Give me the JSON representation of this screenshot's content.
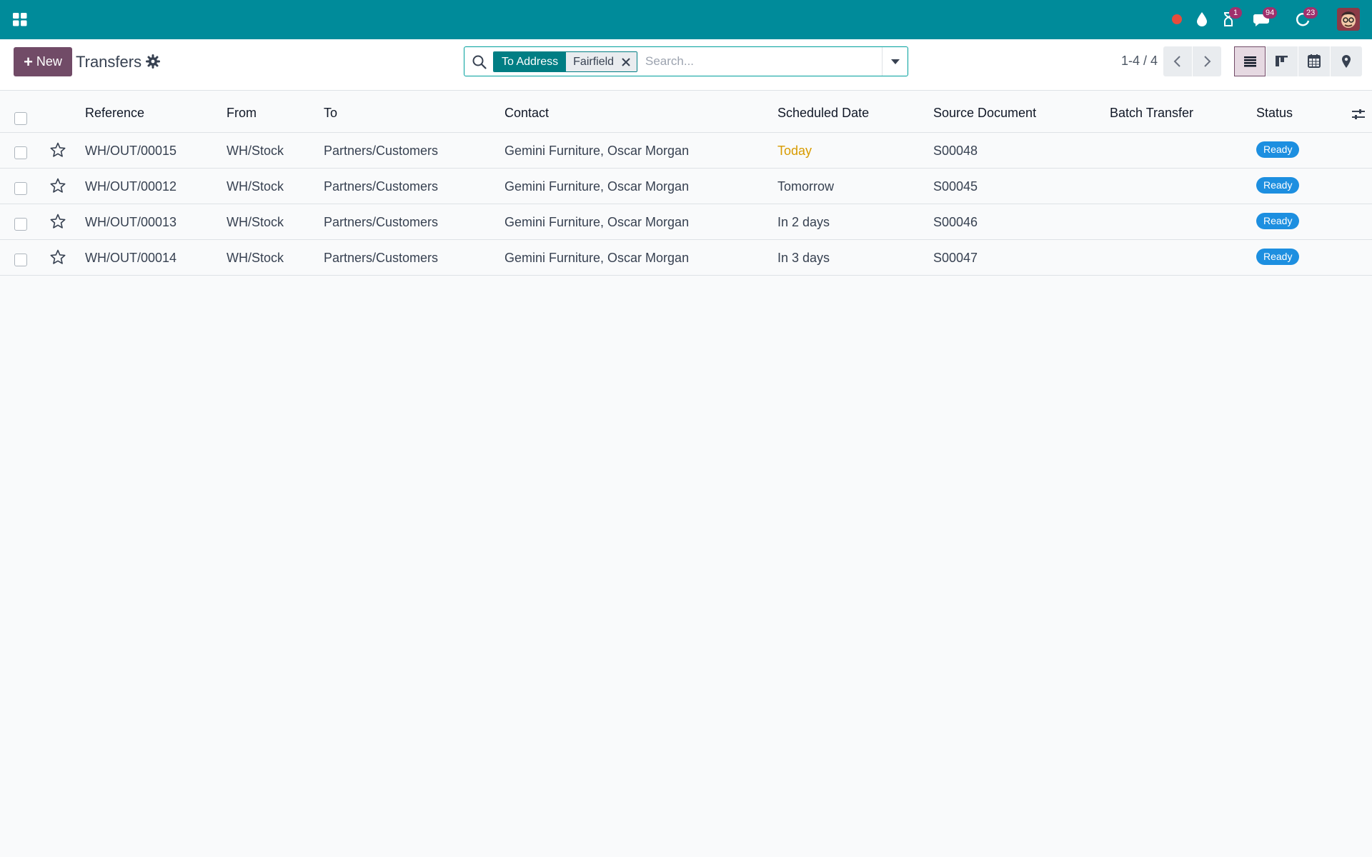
{
  "navbar": {
    "background": "#008b9a",
    "apps_icon": "apps-grid-icon",
    "systray": {
      "activity_badge": "1",
      "messages_badge": "94",
      "followups_badge": "23"
    }
  },
  "control_panel": {
    "new_label": "New",
    "title": "Transfers",
    "search": {
      "facet_label": "To Address",
      "facet_value": "Fairfield",
      "placeholder": "Search..."
    },
    "pager": "1-4 / 4",
    "active_view": "list"
  },
  "list": {
    "columns": [
      "Reference",
      "From",
      "To",
      "Contact",
      "Scheduled Date",
      "Source Document",
      "Batch Transfer",
      "Status"
    ],
    "rows": [
      {
        "reference": "WH/OUT/00015",
        "from": "WH/Stock",
        "to": "Partners/Customers",
        "contact": "Gemini Furniture, Oscar Morgan",
        "scheduled_date": "Today",
        "source_document": "S00048",
        "batch_transfer": "",
        "status": "Ready"
      },
      {
        "reference": "WH/OUT/00012",
        "from": "WH/Stock",
        "to": "Partners/Customers",
        "contact": "Gemini Furniture, Oscar Morgan",
        "scheduled_date": "Tomorrow",
        "source_document": "S00045",
        "batch_transfer": "",
        "status": "Ready"
      },
      {
        "reference": "WH/OUT/00013",
        "from": "WH/Stock",
        "to": "Partners/Customers",
        "contact": "Gemini Furniture, Oscar Morgan",
        "scheduled_date": "In 2 days",
        "source_document": "S00046",
        "batch_transfer": "",
        "status": "Ready"
      },
      {
        "reference": "WH/OUT/00014",
        "from": "WH/Stock",
        "to": "Partners/Customers",
        "contact": "Gemini Furniture, Oscar Morgan",
        "scheduled_date": "In 3 days",
        "source_document": "S00047",
        "batch_transfer": "",
        "status": "Ready"
      }
    ]
  },
  "colors": {
    "brand": "#714b67",
    "accent": "#017e84",
    "status_ready": "#1d8fe0",
    "today": "#d89b00",
    "badge": "#a0306d"
  }
}
